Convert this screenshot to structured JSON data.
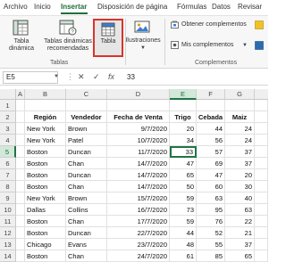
{
  "ribbon_tabs": [
    "Archivo",
    "Inicio",
    "Insertar",
    "Disposición de página",
    "Fórmulas",
    "Datos",
    "Revisar"
  ],
  "active_tab": "Insertar",
  "ribbon": {
    "tabla_dinamica": [
      "Tabla",
      "dinámica"
    ],
    "tablas_recomendadas": [
      "Tablas dinámicas",
      "recomendadas"
    ],
    "tabla": "Tabla",
    "ilustraciones": "Ilustraciones",
    "obtener_complementos": "Obtener complementos",
    "mis_complementos": "Mis complementos",
    "group_tablas": "Tablas",
    "group_complementos": "Complementos"
  },
  "formula_bar": {
    "name_box": "E5",
    "cancel": "✕",
    "enter": "✓",
    "fx": "fx",
    "value": "33"
  },
  "columns": [
    "A",
    "B",
    "C",
    "D",
    "E",
    "F",
    "G"
  ],
  "rows": [
    "1",
    "2",
    "3",
    "4",
    "5",
    "6",
    "7",
    "8",
    "9",
    "10",
    "11",
    "12",
    "13",
    "14"
  ],
  "active_cell": "E5",
  "table": {
    "headers": [
      "Región",
      "Vendedor",
      "Fecha de Venta",
      "Trigo",
      "Cebada",
      "Maiz"
    ],
    "rows": [
      [
        "New York",
        "Brown",
        "9/7/2020",
        "20",
        "44",
        "24"
      ],
      [
        "New York",
        "Patel",
        "10/7/2020",
        "34",
        "56",
        "24"
      ],
      [
        "Boston",
        "Duncan",
        "11/7/2020",
        "33",
        "57",
        "37"
      ],
      [
        "Boston",
        "Chan",
        "14/7/2020",
        "47",
        "69",
        "37"
      ],
      [
        "Boston",
        "Duncan",
        "14/7/2020",
        "65",
        "47",
        "20"
      ],
      [
        "Boston",
        "Chan",
        "14/7/2020",
        "50",
        "60",
        "30"
      ],
      [
        "New York",
        "Brown",
        "15/7/2020",
        "59",
        "63",
        "40"
      ],
      [
        "Dallas",
        "Collins",
        "16/7/2020",
        "73",
        "95",
        "63"
      ],
      [
        "Boston",
        "Chan",
        "17/7/2020",
        "59",
        "76",
        "22"
      ],
      [
        "Boston",
        "Duncan",
        "22/7/2020",
        "44",
        "52",
        "21"
      ],
      [
        "Chicago",
        "Evans",
        "23/7/2020",
        "48",
        "55",
        "37"
      ],
      [
        "Boston",
        "Chan",
        "24/7/2020",
        "61",
        "85",
        "65"
      ]
    ]
  }
}
